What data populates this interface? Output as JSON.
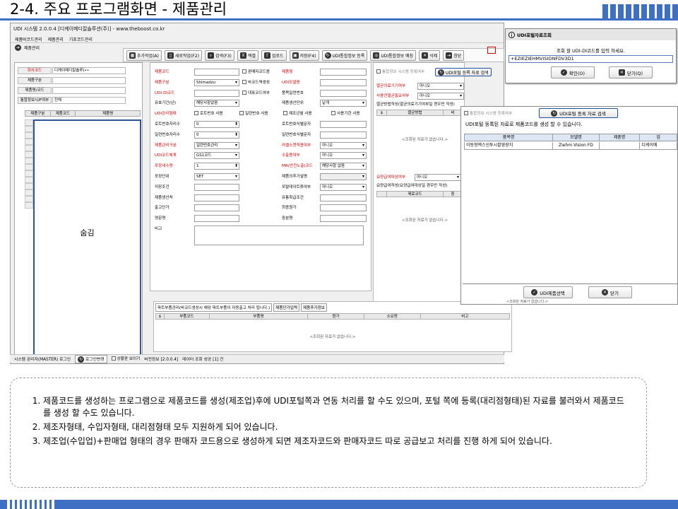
{
  "slide": {
    "title": "2-4. 주요 프로그램화면 - 제품관리",
    "notes": [
      "제품코드를 생성하는 프로그램으로 제품코드를 생성(제조업)후에 UDI포털쪽과 연동 처리를 할 수도 있으며, 포털 쪽에 등록(대리점형태)된 자료를 불러와서 제품코드를 생성 할 수도 있습니다.",
      "제조자형태, 수입자형태, 대리점형태 모두 지원하게 되어 있습니다.",
      "제조업(수입업)+판매업 형태의 경우 판매자 코드용으로 생성하게 되면 제조자코드와 판매자코드 따로 공급보고 처리를 진행 하게 되어 있습니다."
    ]
  },
  "app": {
    "title": "UDI 시스템 2.0.0.4 [디케이메디칼솔루션(주)] - www.theboost.co.kr",
    "menu": [
      "제품바코드관리",
      "제품관리",
      "기초코드관리"
    ],
    "tab": "제품관리",
    "toolbar": {
      "add": "추가작업(A)",
      "new": "새로작업(F2)",
      "search": "검색(F3)",
      "excel": "엑셀",
      "upload": "업로드",
      "save": "저장(F4)",
      "udi_register": "UDI통합정보 등록",
      "udi_match": "UDI통합정보 매칭",
      "delete": "삭제",
      "window": "창닫"
    },
    "left": {
      "labels": [
        "회사코드",
        "제품구분",
        "제품명/코드",
        "통합정보시/F여부"
      ],
      "values": [
        "디케이메디칼솔루(••",
        "",
        "",
        "전체"
      ],
      "grid_headers": [
        "제품구분",
        "제품코드",
        "제품명"
      ],
      "hidden_label": "숨김"
    },
    "form": {
      "col1_labels": [
        "제품코드",
        "제품구분",
        "UDI-DI코드",
        "유효기간(년)",
        "UDI관리형태",
        "로트번호자리수",
        "일련번호자리수",
        "제품관리구분",
        "UDI코드체계",
        "포장내수량",
        "포장단위",
        "저장조건",
        "제품생산처",
        "출고단가",
        "영문명",
        "비고"
      ],
      "col1_values": [
        "",
        "Shimadzu",
        "",
        "해당사항없음",
        "",
        "0",
        "0",
        "일련번호관리",
        "GS1코드",
        "1",
        "SET",
        "",
        "",
        "",
        "",
        ""
      ],
      "checks_row1": [
        "판매자코드용",
        "바코드역생성",
        "대표코드여부"
      ],
      "checks_row5": [
        "로트번호 사용",
        "일련번호 사용",
        "제조년월 사용",
        "사용기한 사용"
      ],
      "col2_labels": [
        "제품명",
        "UDI모델명",
        "품목일련번호",
        "제품생산단위",
        "로트번호식별문자",
        "일련번호식별문자",
        "라벨스캔적용여부",
        "수출용여부",
        "MR(안전노출)코드",
        "제품의추가설명",
        "포탈데이트류여부",
        "유통취급조건",
        "최종원가",
        "중분명"
      ],
      "col2_values": [
        "",
        "",
        "",
        "낱개",
        "",
        "",
        "아니오",
        "아니오",
        "해당사항 없음",
        "",
        "아니오",
        "",
        "",
        ""
      ]
    },
    "right": {
      "chk_label": "통합정보 시스템 등록여부",
      "portal_btn": "UDI포털 등록 자료 검색",
      "labels": [
        "멸균의료기기여부",
        "사용전멸균필요여부",
        "멸균방법작성(멸균의료기기여부일 경우만 작성)"
      ],
      "values": [
        "아니오",
        "아니오"
      ],
      "grid1_headers": [
        "멸균방법",
        "비"
      ],
      "empty1": "<조회된 자료가 없습니다.>",
      "ins_label": "요양급여대상여부",
      "ins_value": "아니오",
      "ins_note": "요양급여작성(요양급여대상일 경우만 작성)",
      "grid2_headers": [
        "제료코드",
        "중"
      ],
      "empty2": "<조회된 자료가 없습니다.>"
    },
    "bottom": {
      "tabs": [
        "파트부품관리(바코드생성시 해당 파트부품이 자동출고 처리 됩니다.)",
        "제품단가입력",
        "제품추가정보"
      ],
      "headers": [
        "$",
        "부품코드",
        "부품명",
        "원가",
        "소요량",
        "비고"
      ],
      "empty": "<조회된 자료가 없습니다.>"
    },
    "status": {
      "user": "시스템 관리자(MASTER) 로그인",
      "login_btn": "로그인변경",
      "toggle": "상황판 보이기",
      "version": "버전정보 [2.0.0.4]",
      "msg": "데이터 조회 성공 [1] 건"
    }
  },
  "dialog_search": {
    "title": "UDI포털자료조회",
    "prompt": "조회 할 UDI-DI코드를 입력 하세요.",
    "value": "+EZIEZIEHMVISIONFDV3D1",
    "ok": "확인(O)",
    "close": "닫기(Q)"
  },
  "dialog_result": {
    "chk_label": "통합정보 시스템 등록여부",
    "search_btn": "UDI포털 등록 자료 검색",
    "caption": "UDI포털 등록된 자료로 제품코드를 생성 할 수 있습니다.",
    "headers": [
      "품목명",
      "모델명",
      "제품명",
      "업"
    ],
    "row": [
      "이동형엑스선투시촬영장치",
      "Ziehm Vision FD",
      "",
      "디케이메"
    ],
    "select_btn": "UDI제품선택",
    "close_btn": "닫기",
    "behind_empty": "<조회된 자료가 없습니다.>"
  }
}
